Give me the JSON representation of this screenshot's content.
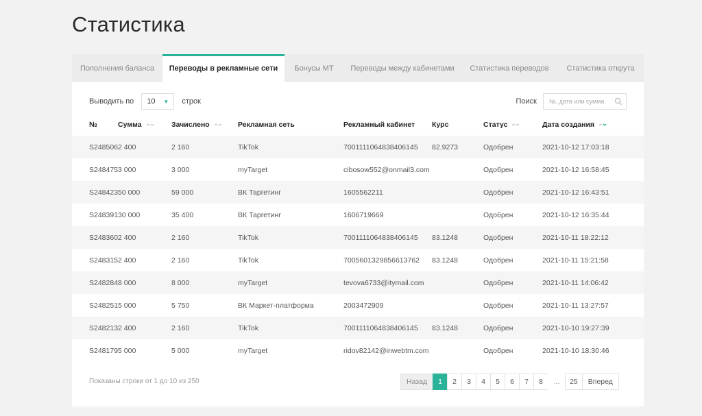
{
  "page": {
    "title": "Статистика"
  },
  "tabs": [
    {
      "label": "Пополнения баланса",
      "active": false
    },
    {
      "label": "Переводы в рекламные сети",
      "active": true
    },
    {
      "label": "Бонусы МТ",
      "active": false
    },
    {
      "label": "Переводы между кабинетами",
      "active": false
    },
    {
      "label": "Статистика переводов",
      "active": false
    },
    {
      "label": "Статистика открута",
      "active": false
    }
  ],
  "controls": {
    "show_label": "Выводить по",
    "page_size": "10",
    "rows_label": "строк",
    "search_label": "Поиск",
    "search_placeholder": "№, дата или сумма"
  },
  "table": {
    "headers": [
      "№",
      "Сумма",
      "Зачислено",
      "Рекламная сеть",
      "Рекламный кабинет",
      "Курс",
      "Статус",
      "Дата создания"
    ],
    "rows": [
      [
        "S248506",
        "2 400",
        "2 160",
        "TikTok",
        "7001111064838406145",
        "82.9273",
        "Одобрен",
        "2021-10-12 17:03:18"
      ],
      [
        "S248475",
        "3 000",
        "3 000",
        "myTarget",
        "cibosow552@onmail3.com",
        "",
        "Одобрен",
        "2021-10-12 16:58:45"
      ],
      [
        "S248423",
        "50 000",
        "59 000",
        "ВК Таргетинг",
        "1605562211",
        "",
        "Одобрен",
        "2021-10-12 16:43:51"
      ],
      [
        "S248391",
        "30 000",
        "35 400",
        "ВК Таргетинг",
        "1606719669",
        "",
        "Одобрен",
        "2021-10-12 16:35:44"
      ],
      [
        "S248360",
        "2 400",
        "2 160",
        "TikTok",
        "7001111064838406145",
        "83.1248",
        "Одобрен",
        "2021-10-11 18:22:12"
      ],
      [
        "S248315",
        "2 400",
        "2 160",
        "TikTok",
        "7005601329856613762",
        "83.1248",
        "Одобрен",
        "2021-10-11 15:21:58"
      ],
      [
        "S248284",
        "8 000",
        "8 000",
        "myTarget",
        "tevova6733@itymail.com",
        "",
        "Одобрен",
        "2021-10-11 14:06:42"
      ],
      [
        "S248251",
        "5 000",
        "5 750",
        "ВК Маркет-платформа",
        "2003472909",
        "",
        "Одобрен",
        "2021-10-11 13:27:57"
      ],
      [
        "S248213",
        "2 400",
        "2 160",
        "TikTok",
        "7001111064838406145",
        "83.1248",
        "Одобрен",
        "2021-10-10 19:27:39"
      ],
      [
        "S248179",
        "5 000",
        "5 000",
        "myTarget",
        "ridov82142@inwebtm.com",
        "",
        "Одобрен",
        "2021-10-10 18:30:46"
      ]
    ]
  },
  "footer": {
    "info": "Показаны строки от 1 до 10 из 250",
    "prev": "Назад",
    "pages": [
      "1",
      "2",
      "3",
      "4",
      "5",
      "6",
      "7",
      "8"
    ],
    "ellipsis": "...",
    "last": "25",
    "next": "Вперед",
    "current_page": "1"
  },
  "colors": {
    "accent": "#2bb39a",
    "background": "#f2f2f2",
    "stripe": "#f5f5f5"
  }
}
